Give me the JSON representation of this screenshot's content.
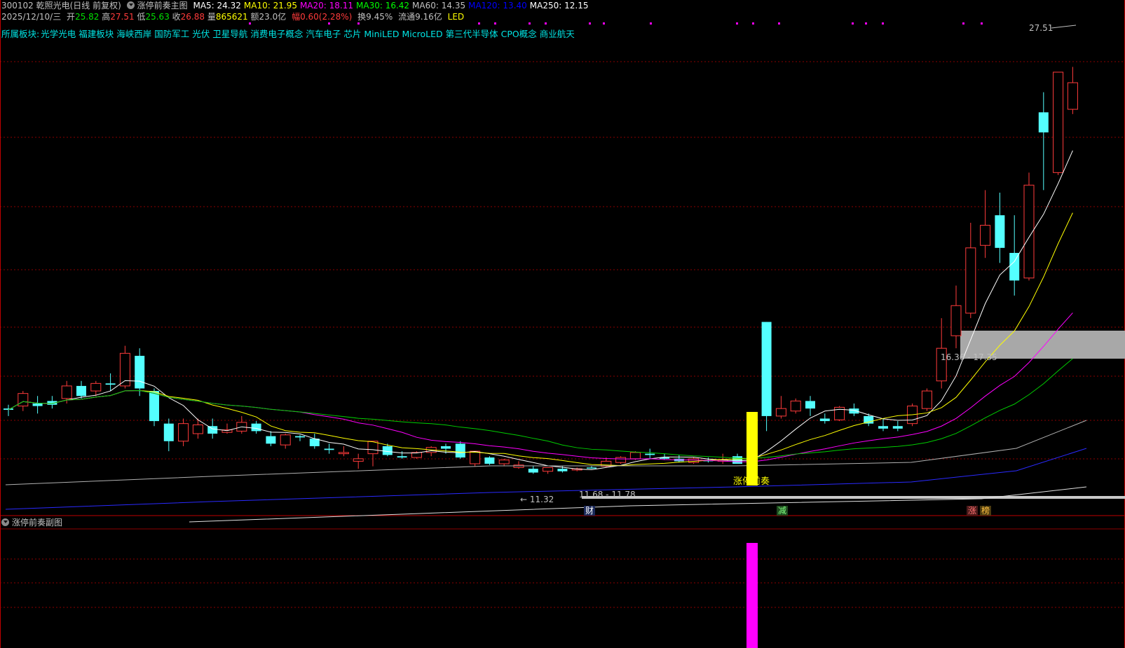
{
  "header": {
    "code_name": "300102 乾照光电",
    "period": "(日线 前复权)",
    "indicator": "涨停前奏主图",
    "ma": [
      {
        "label": "MA5: 24.32",
        "color": "#ffffff"
      },
      {
        "label": "MA10: 21.95",
        "color": "#ffff00"
      },
      {
        "label": "MA20: 18.11",
        "color": "#ff00ff"
      },
      {
        "label": "MA30: 16.42",
        "color": "#00ff00"
      },
      {
        "label": "MA60: 14.35",
        "color": "#c0c0c0"
      },
      {
        "label": "MA120: 13.40",
        "color": "#0000ff"
      },
      {
        "label": "MA250: 12.15",
        "color": "#ffffff"
      }
    ]
  },
  "quote": {
    "date": "2025/12/10/三",
    "open_label": "开",
    "open": "25.82",
    "high_label": "高",
    "high": "27.51",
    "low_label": "低",
    "low": "25.63",
    "close_label": "收",
    "close": "26.88",
    "vol_label": "量",
    "vol": "865621",
    "amount": "额23.0亿",
    "change": "幅0.60(2.28%)",
    "turnover": "换9.45%",
    "float": "流通9.16亿",
    "industry": "LED"
  },
  "sectors": {
    "label": "所属板块:",
    "items": [
      "光学光电",
      "福建板块",
      "海峡西岸",
      "国防军工",
      "光伏",
      "卫星导航",
      "消费电子概念",
      "汽车电子",
      "芯片",
      "MiniLED",
      "MicroLED",
      "第三代半导体",
      "CPO概念",
      "商业航天"
    ]
  },
  "annotations": {
    "high_price": "27.51",
    "low_marker": "← 11.32",
    "range_low": "11.68 - 11.78",
    "range_zone": "16.36 - 17.35",
    "signal_label": "涨停前奏",
    "event_cai": "财",
    "event_jian": "减",
    "event_zhang": "涨",
    "event_bang": "榜"
  },
  "sub_panel": {
    "title": "涨停前奏副图"
  },
  "colors": {
    "up": "#ff3b3b",
    "down": "#54ffff",
    "grid": "#8b0000",
    "signal": "#ffff00",
    "sub_bar": "#ff00ff"
  },
  "chart_data": {
    "type": "candlestick",
    "price_range": [
      10.5,
      28.5
    ],
    "candles": [
      [
        13.9,
        14.05,
        13.6,
        13.85
      ],
      [
        14.0,
        14.6,
        13.8,
        14.5
      ],
      [
        14.1,
        14.4,
        13.7,
        14.0
      ],
      [
        14.2,
        14.4,
        13.9,
        14.05
      ],
      [
        14.3,
        15.0,
        14.1,
        14.8
      ],
      [
        14.8,
        15.0,
        14.3,
        14.4
      ],
      [
        14.6,
        15.0,
        14.4,
        14.9
      ],
      [
        14.9,
        15.3,
        14.6,
        14.85
      ],
      [
        14.8,
        16.4,
        14.7,
        16.1
      ],
      [
        16.0,
        16.3,
        14.4,
        14.7
      ],
      [
        14.6,
        14.7,
        13.2,
        13.4
      ],
      [
        13.3,
        13.5,
        12.2,
        12.6
      ],
      [
        12.6,
        13.5,
        12.4,
        13.3
      ],
      [
        12.9,
        13.5,
        12.7,
        13.25
      ],
      [
        13.2,
        13.5,
        12.7,
        12.9
      ],
      [
        12.95,
        13.3,
        12.9,
        13.05
      ],
      [
        13.0,
        13.6,
        12.9,
        13.35
      ],
      [
        13.3,
        13.4,
        12.9,
        13.0
      ],
      [
        12.8,
        13.0,
        12.4,
        12.5
      ],
      [
        12.45,
        12.9,
        12.3,
        12.85
      ],
      [
        12.8,
        12.85,
        12.6,
        12.75
      ],
      [
        12.7,
        12.9,
        12.3,
        12.4
      ],
      [
        12.3,
        12.5,
        12.1,
        12.25
      ],
      [
        12.1,
        12.4,
        12.0,
        12.15
      ],
      [
        11.8,
        12.1,
        11.5,
        11.9
      ],
      [
        12.1,
        12.6,
        11.6,
        12.6
      ],
      [
        12.4,
        12.5,
        12.0,
        12.05
      ],
      [
        12.0,
        12.2,
        11.9,
        11.95
      ],
      [
        11.95,
        12.2,
        11.9,
        12.15
      ],
      [
        12.15,
        12.4,
        12.0,
        12.35
      ],
      [
        12.4,
        12.5,
        12.1,
        12.3
      ],
      [
        12.5,
        12.6,
        11.9,
        11.95
      ],
      [
        11.7,
        12.2,
        11.6,
        12.2
      ],
      [
        11.95,
        12.0,
        11.65,
        11.7
      ],
      [
        11.7,
        11.9,
        11.6,
        11.85
      ],
      [
        11.55,
        11.8,
        11.5,
        11.65
      ],
      [
        11.5,
        11.6,
        11.3,
        11.35
      ],
      [
        11.4,
        11.55,
        11.3,
        11.55
      ],
      [
        11.5,
        11.6,
        11.35,
        11.4
      ],
      [
        11.45,
        11.55,
        11.4,
        11.5
      ],
      [
        11.55,
        11.6,
        11.5,
        11.52
      ],
      [
        11.6,
        11.95,
        11.55,
        11.8
      ],
      [
        11.75,
        12.0,
        11.7,
        11.95
      ],
      [
        11.9,
        12.2,
        11.85,
        12.15
      ],
      [
        12.1,
        12.3,
        11.9,
        12.05
      ],
      [
        11.95,
        12.1,
        11.85,
        11.9
      ],
      [
        11.9,
        12.05,
        11.75,
        11.8
      ],
      [
        11.75,
        11.95,
        11.7,
        11.9
      ],
      [
        11.85,
        11.95,
        11.75,
        11.8
      ],
      [
        11.8,
        12.1,
        11.7,
        11.85
      ],
      [
        12.0,
        12.1,
        11.7,
        11.7
      ],
      [
        11.8,
        12.1,
        11.7,
        12.0
      ],
      [
        17.35,
        17.35,
        13.0,
        13.6
      ],
      [
        13.6,
        14.4,
        13.5,
        13.9
      ],
      [
        13.8,
        14.3,
        13.7,
        14.2
      ],
      [
        14.2,
        14.4,
        13.6,
        13.9
      ],
      [
        13.5,
        13.7,
        13.3,
        13.4
      ],
      [
        13.45,
        14.0,
        13.4,
        13.95
      ],
      [
        13.9,
        14.1,
        13.6,
        13.7
      ],
      [
        13.6,
        13.7,
        13.2,
        13.3
      ],
      [
        13.2,
        13.5,
        13.0,
        13.1
      ],
      [
        13.2,
        13.4,
        13.0,
        13.1
      ],
      [
        13.3,
        14.1,
        13.2,
        14.0
      ],
      [
        13.9,
        14.7,
        13.8,
        14.6
      ],
      [
        15.0,
        17.5,
        14.7,
        16.3
      ],
      [
        16.8,
        18.8,
        16.3,
        18.0
      ],
      [
        17.7,
        21.3,
        17.5,
        20.3
      ],
      [
        20.4,
        22.6,
        19.9,
        21.2
      ],
      [
        21.6,
        22.5,
        19.7,
        20.3
      ],
      [
        20.1,
        21.6,
        18.4,
        19.0
      ],
      [
        19.1,
        23.3,
        19.0,
        22.8
      ],
      [
        25.7,
        26.5,
        22.6,
        24.9
      ],
      [
        23.3,
        26.8,
        23.2,
        27.3
      ],
      [
        25.82,
        27.51,
        25.63,
        26.88
      ]
    ]
  }
}
